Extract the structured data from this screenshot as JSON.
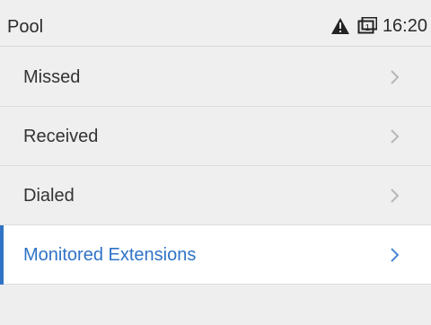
{
  "status_bar": {
    "title": "Pool",
    "time": "16:20",
    "icons": [
      "warning-icon",
      "line-icon"
    ]
  },
  "menu": {
    "items": [
      {
        "label": "Missed",
        "selected": false,
        "icon": "chevron-right-icon"
      },
      {
        "label": "Received",
        "selected": false,
        "icon": "chevron-right-icon"
      },
      {
        "label": "Dialed",
        "selected": false,
        "icon": "chevron-right-icon"
      },
      {
        "label": "Monitored Extensions",
        "selected": true,
        "icon": "chevron-right-icon"
      }
    ]
  },
  "colors": {
    "background": "#eeeeee",
    "selected_text": "#2f73c7",
    "text": "#333333",
    "selected_background": "#ffffff"
  }
}
